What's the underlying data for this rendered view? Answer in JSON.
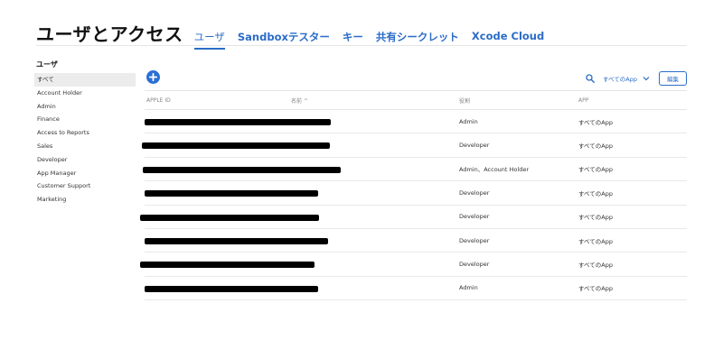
{
  "header": {
    "title": "ユーザとアクセス",
    "tabs": [
      {
        "label": "ユーザ",
        "active": true
      },
      {
        "label": "Sandboxテスター",
        "active": false
      },
      {
        "label": "キー",
        "active": false
      },
      {
        "label": "共有シークレット",
        "active": false
      },
      {
        "label": "Xcode Cloud",
        "active": false
      }
    ]
  },
  "sidebar": {
    "heading": "ユーザ",
    "items": [
      {
        "label": "すべて",
        "selected": true
      },
      {
        "label": "Account Holder"
      },
      {
        "label": "Admin"
      },
      {
        "label": "Finance"
      },
      {
        "label": "Access to Reports"
      },
      {
        "label": "Sales"
      },
      {
        "label": "Developer"
      },
      {
        "label": "App Manager"
      },
      {
        "label": "Customer Support"
      },
      {
        "label": "Marketing"
      }
    ]
  },
  "toolbar": {
    "add_icon": "plus-icon",
    "search_icon": "search-icon",
    "filter_label": "すべてのApp",
    "edit_label": "編集"
  },
  "table": {
    "columns": {
      "apple_id": "APPLE ID",
      "name": "名前",
      "name_sort": "^",
      "role": "役割",
      "app": "APP"
    },
    "rows": [
      {
        "role": "Admin",
        "app": "すべてのApp"
      },
      {
        "role": "Developer",
        "app": "すべてのApp"
      },
      {
        "role": "Admin、Account Holder",
        "app": "すべてのApp"
      },
      {
        "role": "Developer",
        "app": "すべてのApp"
      },
      {
        "role": "Developer",
        "app": "すべてのApp"
      },
      {
        "role": "Developer",
        "app": "すべてのApp"
      },
      {
        "role": "Developer",
        "app": "すべてのApp"
      },
      {
        "role": "Admin",
        "app": "すべてのApp"
      }
    ]
  },
  "colors": {
    "accent": "#2b6cc8",
    "redaction": "#000000"
  }
}
